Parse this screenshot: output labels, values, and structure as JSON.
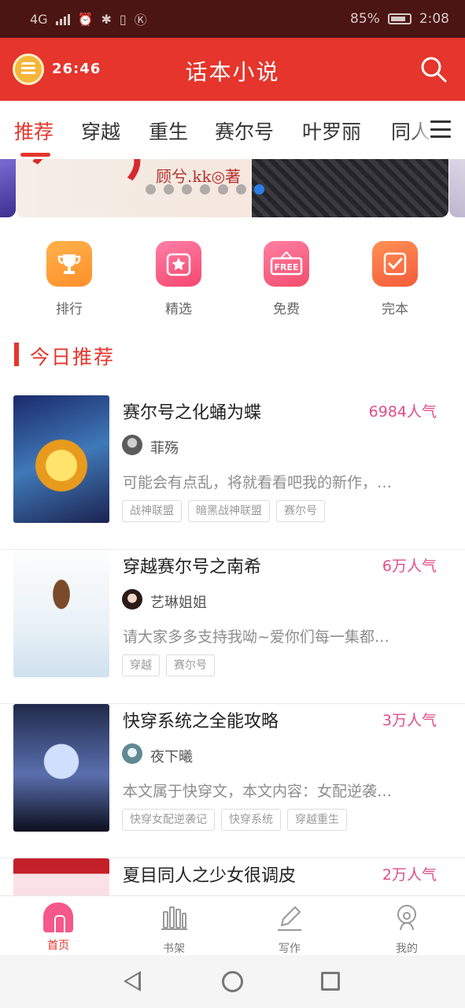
{
  "status_bar": {
    "network": "4G",
    "battery": "85%",
    "time": "2:08"
  },
  "header": {
    "timer": "26:46",
    "title": "话本小说"
  },
  "tabs": [
    "推荐",
    "穿越",
    "重生",
    "赛尔号",
    "叶罗丽",
    "同人"
  ],
  "banner": {
    "author_text": "顾兮.kk◎著",
    "dots": 7,
    "active_dot": 7
  },
  "quick_actions": [
    {
      "label": "排行",
      "icon": "trophy-icon"
    },
    {
      "label": "精选",
      "icon": "star-icon"
    },
    {
      "label": "免费",
      "icon": "free-sign-icon",
      "badge": "FREE"
    },
    {
      "label": "完本",
      "icon": "check-icon"
    }
  ],
  "section": {
    "title": "今日推荐"
  },
  "books": [
    {
      "title": "赛尔号之化蛹为蝶",
      "popularity": "6984人气",
      "author": "菲殇",
      "description": "可能会有点乱，将就看看吧我的新作，…",
      "tags": [
        "战神联盟",
        "暗黑战神联盟",
        "赛尔号"
      ]
    },
    {
      "title": "穿越赛尔号之南希",
      "popularity": "6万人气",
      "author": "艺琳姐姐",
      "description": "请大家多多支持我呦~爱你们每一集都…",
      "tags": [
        "穿越",
        "赛尔号"
      ]
    },
    {
      "title": "快穿系统之全能攻略",
      "popularity": "3万人气",
      "author": "夜下曦",
      "description": "本文属于快穿文，本文内容：女配逆袭…",
      "tags": [
        "快穿女配逆袭记",
        "快穿系统",
        "穿越重生"
      ]
    },
    {
      "title": "夏目同人之少女很调皮",
      "popularity": "2万人气"
    }
  ],
  "bottom_nav": [
    {
      "label": "首页",
      "active": true
    },
    {
      "label": "书架",
      "active": false
    },
    {
      "label": "写作",
      "active": false
    },
    {
      "label": "我的",
      "active": false
    }
  ],
  "colors": {
    "brand_red": "#e5352c",
    "status_bar": "#4a1512",
    "popularity_pink": "#e04e8a"
  }
}
